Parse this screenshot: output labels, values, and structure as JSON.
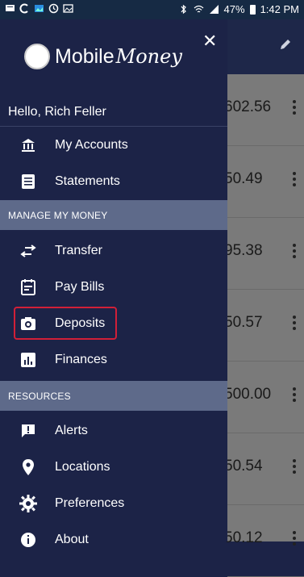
{
  "status_bar": {
    "battery": "47%",
    "time": "1:42 PM"
  },
  "drawer": {
    "logo_text": "Mobile",
    "logo_script": "Money",
    "greeting": "Hello, Rich Feller",
    "items_top": [
      {
        "label": "My Accounts",
        "icon": "bank-icon"
      },
      {
        "label": "Statements",
        "icon": "document-icon"
      }
    ],
    "section_manage": "MANAGE MY MONEY",
    "items_manage": [
      {
        "label": "Transfer",
        "icon": "swap-arrows-icon"
      },
      {
        "label": "Pay Bills",
        "icon": "bill-icon"
      },
      {
        "label": "Deposits",
        "icon": "camera-icon"
      },
      {
        "label": "Finances",
        "icon": "bar-chart-icon"
      }
    ],
    "section_resources": "RESOURCES",
    "items_resources": [
      {
        "label": "Alerts",
        "icon": "alert-icon"
      },
      {
        "label": "Locations",
        "icon": "location-pin-icon"
      },
      {
        "label": "Preferences",
        "icon": "gear-icon"
      },
      {
        "label": "About",
        "icon": "info-icon"
      }
    ]
  },
  "background_accounts": {
    "amounts": [
      "602.56",
      "50.49",
      "95.38",
      "50.57",
      "500.00",
      "50.54",
      "50.12"
    ]
  },
  "colors": {
    "drawer_bg": "#1c2347",
    "section_bg": "#5e6a8a",
    "highlight": "#d11f38"
  }
}
